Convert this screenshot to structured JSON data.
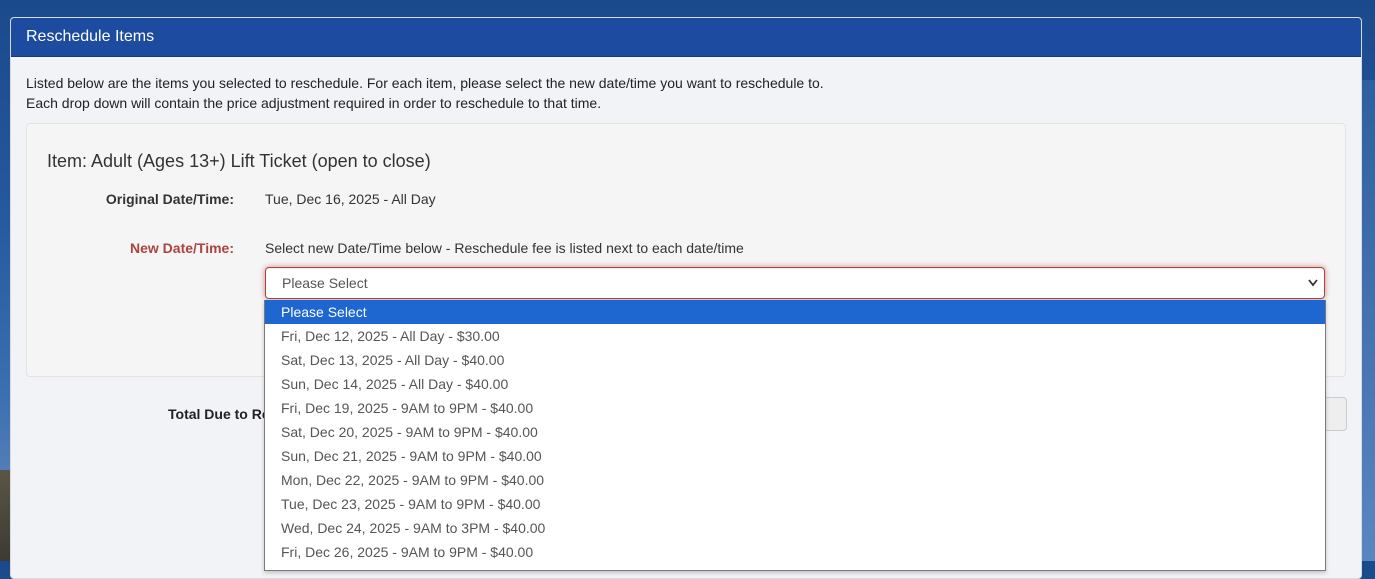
{
  "panel": {
    "title": "Reschedule Items",
    "intro_line1": "Listed below are the items you selected to reschedule. For each item, please select the new date/time you want to reschedule to.",
    "intro_line2": "Each drop down will contain the price adjustment required in order to reschedule to that time."
  },
  "item": {
    "title": "Item: Adult (Ages 13+) Lift Ticket (open to close)",
    "original_label": "Original Date/Time:",
    "original_value": "Tue, Dec 16, 2025 - All Day",
    "new_label": "New Date/Time:",
    "new_help": "Select new Date/Time below - Reschedule fee is listed next to each date/time",
    "select_value": "Please Select"
  },
  "total": {
    "label": "Total Due to Re"
  },
  "dropdown": {
    "options": [
      "Please Select",
      "Fri, Dec 12, 2025 - All Day - $30.00",
      "Sat, Dec 13, 2025 - All Day - $40.00",
      "Sun, Dec 14, 2025 - All Day - $40.00",
      "Fri, Dec 19, 2025 - 9AM to 9PM - $40.00",
      "Sat, Dec 20, 2025 - 9AM to 9PM - $40.00",
      "Sun, Dec 21, 2025 - 9AM to 9PM - $40.00",
      "Mon, Dec 22, 2025 - 9AM to 9PM - $40.00",
      "Tue, Dec 23, 2025 - 9AM to 9PM - $40.00",
      "Wed, Dec 24, 2025 - 9AM to 3PM - $40.00",
      "Fri, Dec 26, 2025 - 9AM to 9PM - $40.00"
    ],
    "selected_index": 0
  },
  "icons": {
    "select_arrow": "chevron-down-icon"
  },
  "colors": {
    "header_bg": "#1d4ba0",
    "highlight": "#1e66d0",
    "error_label": "#a94442"
  }
}
